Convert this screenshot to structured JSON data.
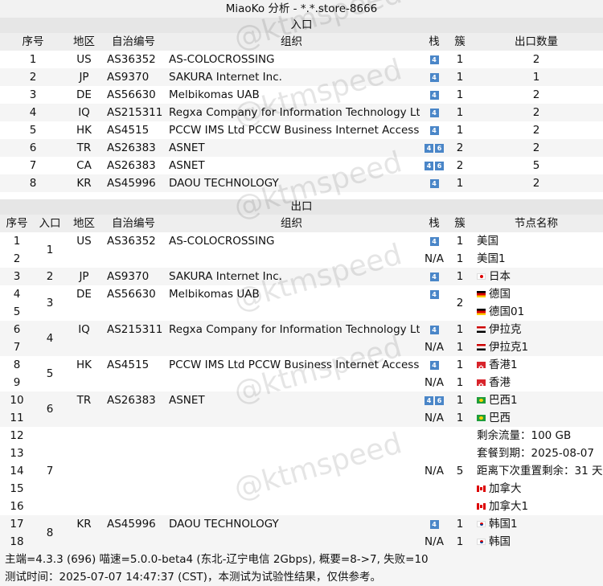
{
  "title": "MiaoKo 分析 - *.*.store-8666",
  "inbound": {
    "section": "入口",
    "headers": {
      "idx": "序号",
      "region": "地区",
      "asn": "自治编号",
      "org": "组织",
      "stack": "栈",
      "cluster": "簇",
      "count": "出口数量"
    },
    "rows": [
      {
        "idx": "1",
        "region": "US",
        "asn": "AS36352",
        "org": "AS-COLOCROSSING",
        "stack": [
          "4"
        ],
        "cluster": "1",
        "count": "2"
      },
      {
        "idx": "2",
        "region": "JP",
        "asn": "AS9370",
        "org": "SAKURA Internet Inc.",
        "stack": [
          "4"
        ],
        "cluster": "1",
        "count": "1"
      },
      {
        "idx": "3",
        "region": "DE",
        "asn": "AS56630",
        "org": "Melbikomas UAB",
        "stack": [
          "4"
        ],
        "cluster": "1",
        "count": "2"
      },
      {
        "idx": "4",
        "region": "IQ",
        "asn": "AS215311",
        "org": "Regxa Company for Information Technology Ltd",
        "stack": [
          "4"
        ],
        "cluster": "1",
        "count": "2"
      },
      {
        "idx": "5",
        "region": "HK",
        "asn": "AS4515",
        "org": "PCCW IMS Ltd PCCW Business Internet Access",
        "stack": [
          "4"
        ],
        "cluster": "1",
        "count": "2"
      },
      {
        "idx": "6",
        "region": "TR",
        "asn": "AS26383",
        "org": "ASNET",
        "stack": [
          "4",
          "6"
        ],
        "cluster": "2",
        "count": "2"
      },
      {
        "idx": "7",
        "region": "CA",
        "asn": "AS26383",
        "org": "ASNET",
        "stack": [
          "4",
          "6"
        ],
        "cluster": "2",
        "count": "5"
      },
      {
        "idx": "8",
        "region": "KR",
        "asn": "AS45996",
        "org": "DAOU TECHNOLOGY",
        "stack": [
          "4"
        ],
        "cluster": "1",
        "count": "2"
      }
    ]
  },
  "outbound": {
    "section": "出口",
    "headers": {
      "idx": "序号",
      "entry": "入口",
      "region": "地区",
      "asn": "自治编号",
      "org": "组织",
      "stack": "栈",
      "cluster": "簇",
      "node": "节点名称"
    },
    "rows": [
      {
        "idx": "1",
        "stack": [
          "4"
        ],
        "cluster": "1",
        "node": "美国",
        "flag": ""
      },
      {
        "idx": "2",
        "stack_na": "N/A",
        "cluster": "1",
        "node": "美国1",
        "flag": ""
      },
      {
        "idx": "3",
        "stack": [
          "4"
        ],
        "cluster": "1",
        "node": "日本",
        "flag": "jp"
      },
      {
        "idx": "4",
        "stack": [
          "4"
        ],
        "node": "德国",
        "flag": "de"
      },
      {
        "idx": "5",
        "node": "德国01",
        "flag": "de"
      },
      {
        "idx": "6",
        "stack": [
          "4"
        ],
        "cluster": "1",
        "node": "伊拉克",
        "flag": "iq"
      },
      {
        "idx": "7",
        "stack_na": "N/A",
        "cluster": "1",
        "node": "伊拉克1",
        "flag": "iq"
      },
      {
        "idx": "8",
        "stack": [
          "4"
        ],
        "cluster": "1",
        "node": "香港1",
        "flag": "hk"
      },
      {
        "idx": "9",
        "stack_na": "N/A",
        "cluster": "1",
        "node": "香港",
        "flag": "hk"
      },
      {
        "idx": "10",
        "stack": [
          "4",
          "6"
        ],
        "cluster": "1",
        "node": "巴西1",
        "flag": "br"
      },
      {
        "idx": "11",
        "stack_na": "N/A",
        "cluster": "1",
        "node": "巴西",
        "flag": "br"
      },
      {
        "idx": "12",
        "node": "剩余流量：100 GB",
        "flag": ""
      },
      {
        "idx": "13",
        "node": "套餐到期：2025-08-07",
        "flag": ""
      },
      {
        "idx": "14",
        "node": "距离下次重置剩余：31 天",
        "flag": ""
      },
      {
        "idx": "15",
        "node": "加拿大",
        "flag": "ca"
      },
      {
        "idx": "16",
        "node": "加拿大1",
        "flag": "ca"
      },
      {
        "idx": "17",
        "stack": [
          "4"
        ],
        "cluster": "1",
        "node": "韩国1",
        "flag": "kr"
      },
      {
        "idx": "18",
        "stack_na": "N/A",
        "cluster": "1",
        "node": "韩国",
        "flag": "kr"
      }
    ],
    "groups": [
      {
        "entry": "1",
        "region": "US",
        "asn": "AS36352",
        "org": "AS-COLOCROSSING",
        "start": 0,
        "len": 2
      },
      {
        "entry": "2",
        "region": "JP",
        "asn": "AS9370",
        "org": "SAKURA Internet Inc.",
        "start": 2,
        "len": 1
      },
      {
        "entry": "3",
        "region": "DE",
        "asn": "AS56630",
        "org": "Melbikomas UAB",
        "start": 3,
        "len": 2,
        "cluster": "2"
      },
      {
        "entry": "4",
        "region": "IQ",
        "asn": "AS215311",
        "org": "Regxa Company for Information Technology Ltd",
        "start": 5,
        "len": 2
      },
      {
        "entry": "5",
        "region": "HK",
        "asn": "AS4515",
        "org": "PCCW IMS Ltd PCCW Business Internet Access",
        "start": 7,
        "len": 2
      },
      {
        "entry": "6",
        "region": "TR",
        "asn": "AS26383",
        "org": "ASNET",
        "start": 9,
        "len": 2
      },
      {
        "entry": "7",
        "start": 11,
        "len": 5,
        "stack_na": "N/A",
        "cluster": "5"
      },
      {
        "entry": "8",
        "region": "KR",
        "asn": "AS45996",
        "org": "DAOU TECHNOLOGY",
        "start": 16,
        "len": 2
      }
    ]
  },
  "footer": {
    "line1": "主端=4.3.3 (696) 喵速=5.0.0-beta4 (东北-辽宁电信 2Gbps), 概要=8->7, 失败=10",
    "line2": "测试时间：2025-07-07 14:47:37 (CST)，本测试为试验性结果，仅供参考。"
  },
  "watermark": "@ktmspeed"
}
